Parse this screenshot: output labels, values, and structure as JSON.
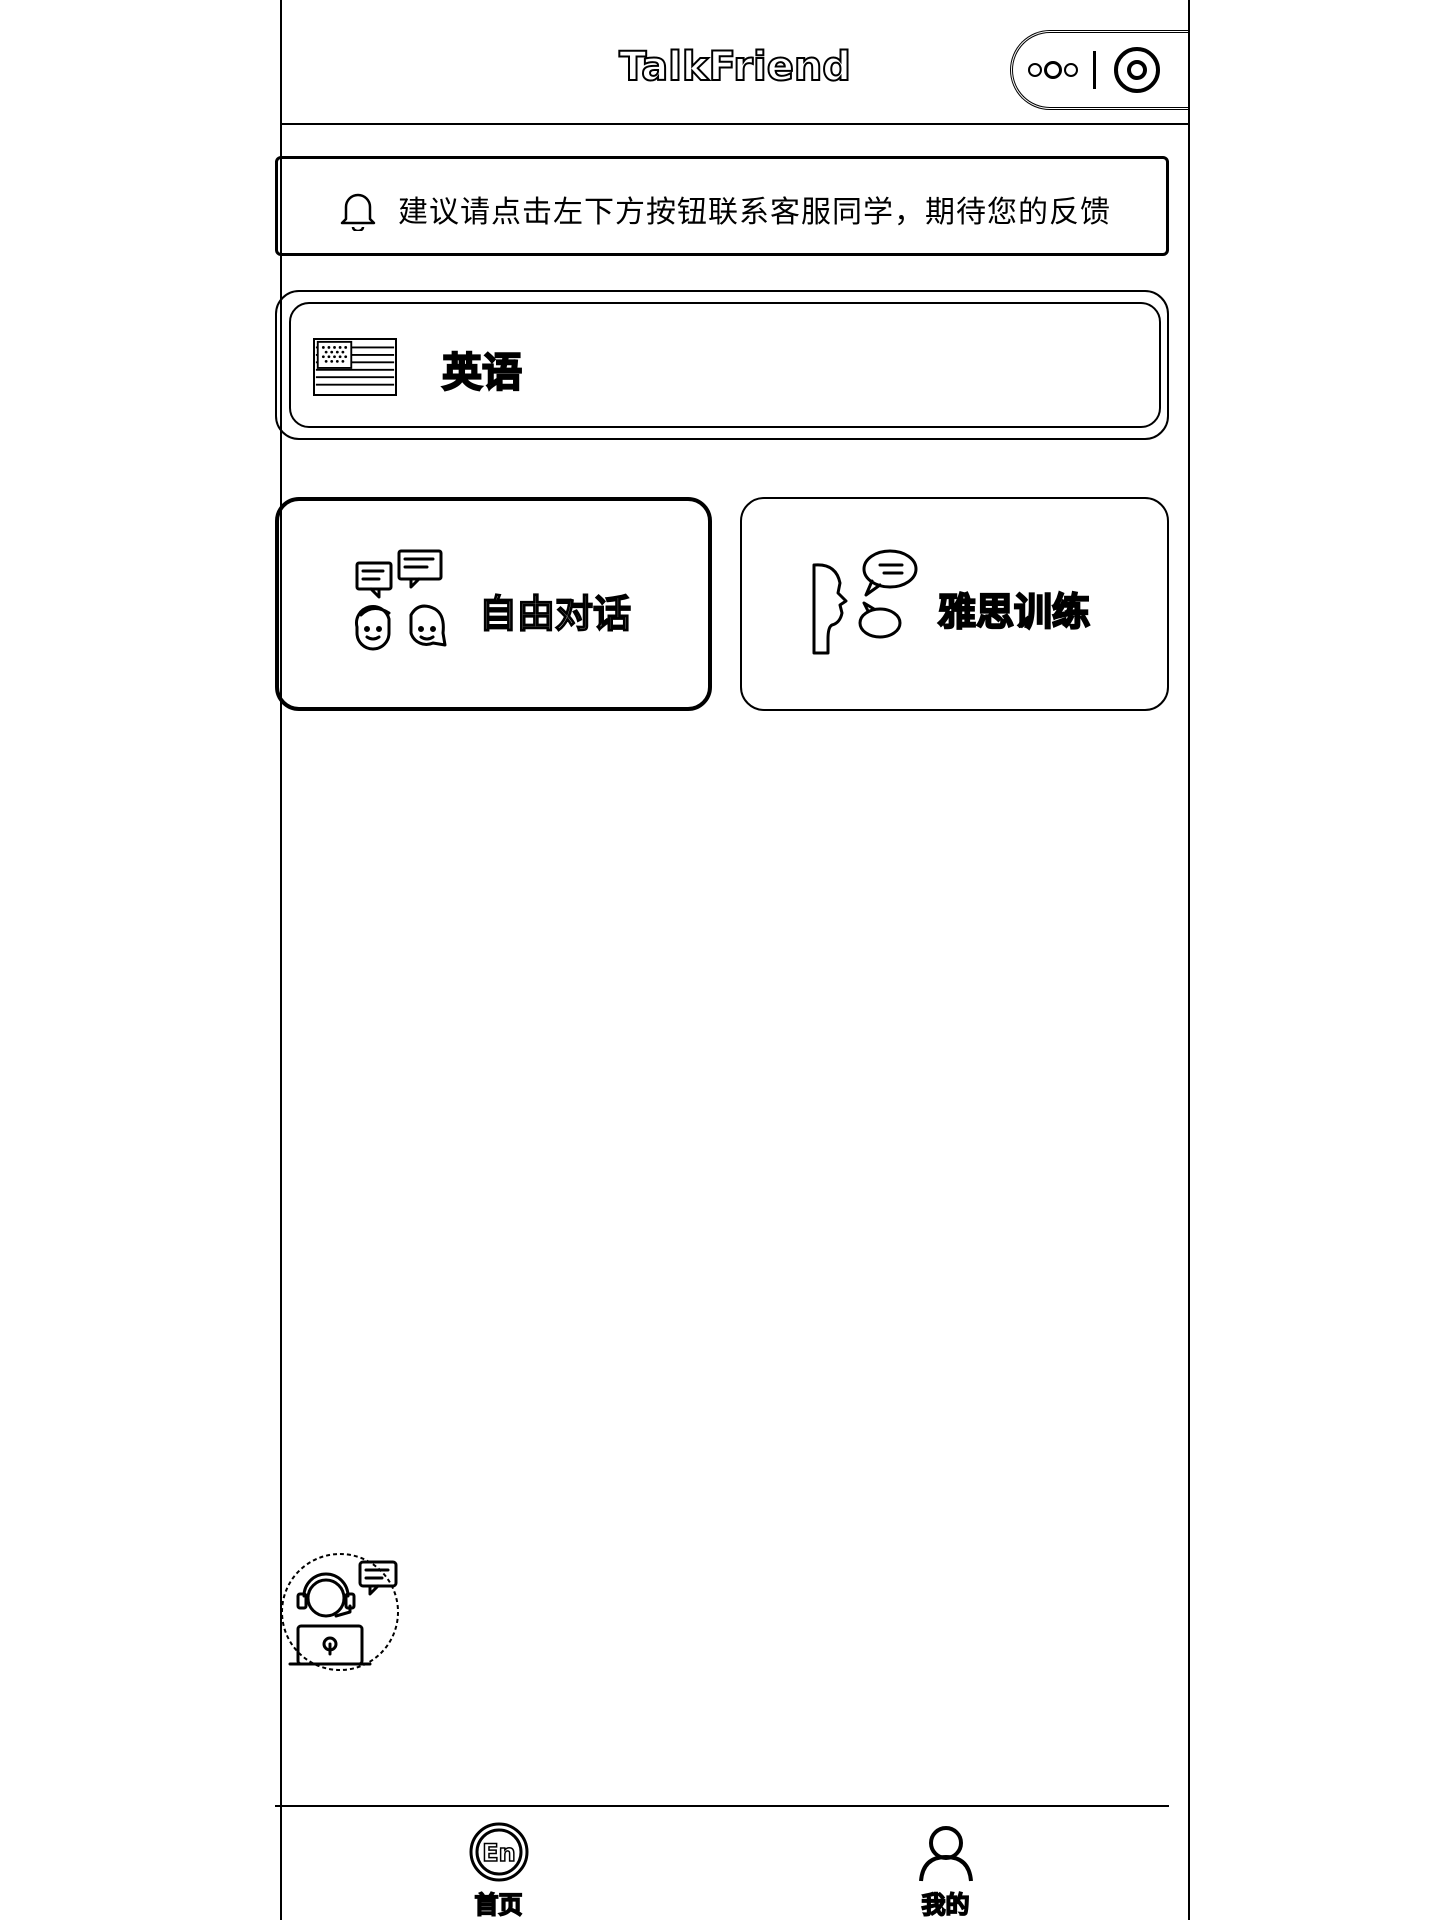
{
  "header": {
    "title": "TalkFriend",
    "capsule": {
      "more_icon": "more-dots-icon",
      "close_icon": "target-circle-icon"
    }
  },
  "notice": {
    "icon": "bell-icon",
    "text": "建议请点击左下方按钮联系客服同学，期待您的反馈"
  },
  "language": {
    "flag_icon": "us-flag-icon",
    "name": "英语"
  },
  "features": [
    {
      "label": "自由对话",
      "icon": "conversation-icon"
    },
    {
      "label": "雅思训练",
      "icon": "speaking-icon"
    }
  ],
  "customer_service": {
    "icon": "customer-service-icon"
  },
  "tabbar": {
    "items": [
      {
        "label": "首页",
        "icon": "en-badge-icon"
      },
      {
        "label": "我的",
        "icon": "user-icon"
      }
    ]
  }
}
